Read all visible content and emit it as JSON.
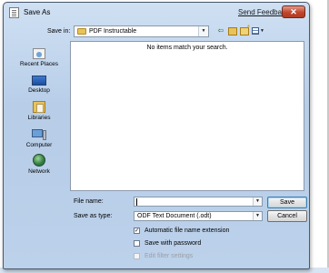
{
  "dialog": {
    "title": "Save As",
    "feedback_link": "Send Feedback",
    "close_glyph": "✕"
  },
  "toolbar": {
    "save_in_label": "Save in:",
    "save_in_value": "PDF Instructable",
    "dropdown_glyph": "▼",
    "back_glyph": "⇦",
    "view_arrow_glyph": "▼"
  },
  "places": [
    {
      "label": "Recent Places",
      "icon": "recent-places-icon"
    },
    {
      "label": "Desktop",
      "icon": "desktop-icon"
    },
    {
      "label": "Libraries",
      "icon": "libraries-icon"
    },
    {
      "label": "Computer",
      "icon": "computer-icon"
    },
    {
      "label": "Network",
      "icon": "network-icon"
    }
  ],
  "file_list": {
    "empty_message": "No items match your search."
  },
  "form": {
    "file_name_label": "File name:",
    "file_name_value": "",
    "save_as_type_label": "Save as type:",
    "save_as_type_value": "ODF Text Document (.odt)"
  },
  "buttons": {
    "save": "Save",
    "cancel": "Cancel"
  },
  "options": {
    "auto_extension": {
      "label": "Automatic file name extension",
      "checked": true,
      "glyph": "✓"
    },
    "save_with_password": {
      "label": "Save with password",
      "checked": false
    },
    "edit_filter_settings": {
      "label": "Edit filter settings",
      "checked": false,
      "disabled": true
    }
  },
  "colors": {
    "window_frame": "#b7cde8",
    "close_button": "#c0452c",
    "default_button_border": "#3c7fb1"
  }
}
